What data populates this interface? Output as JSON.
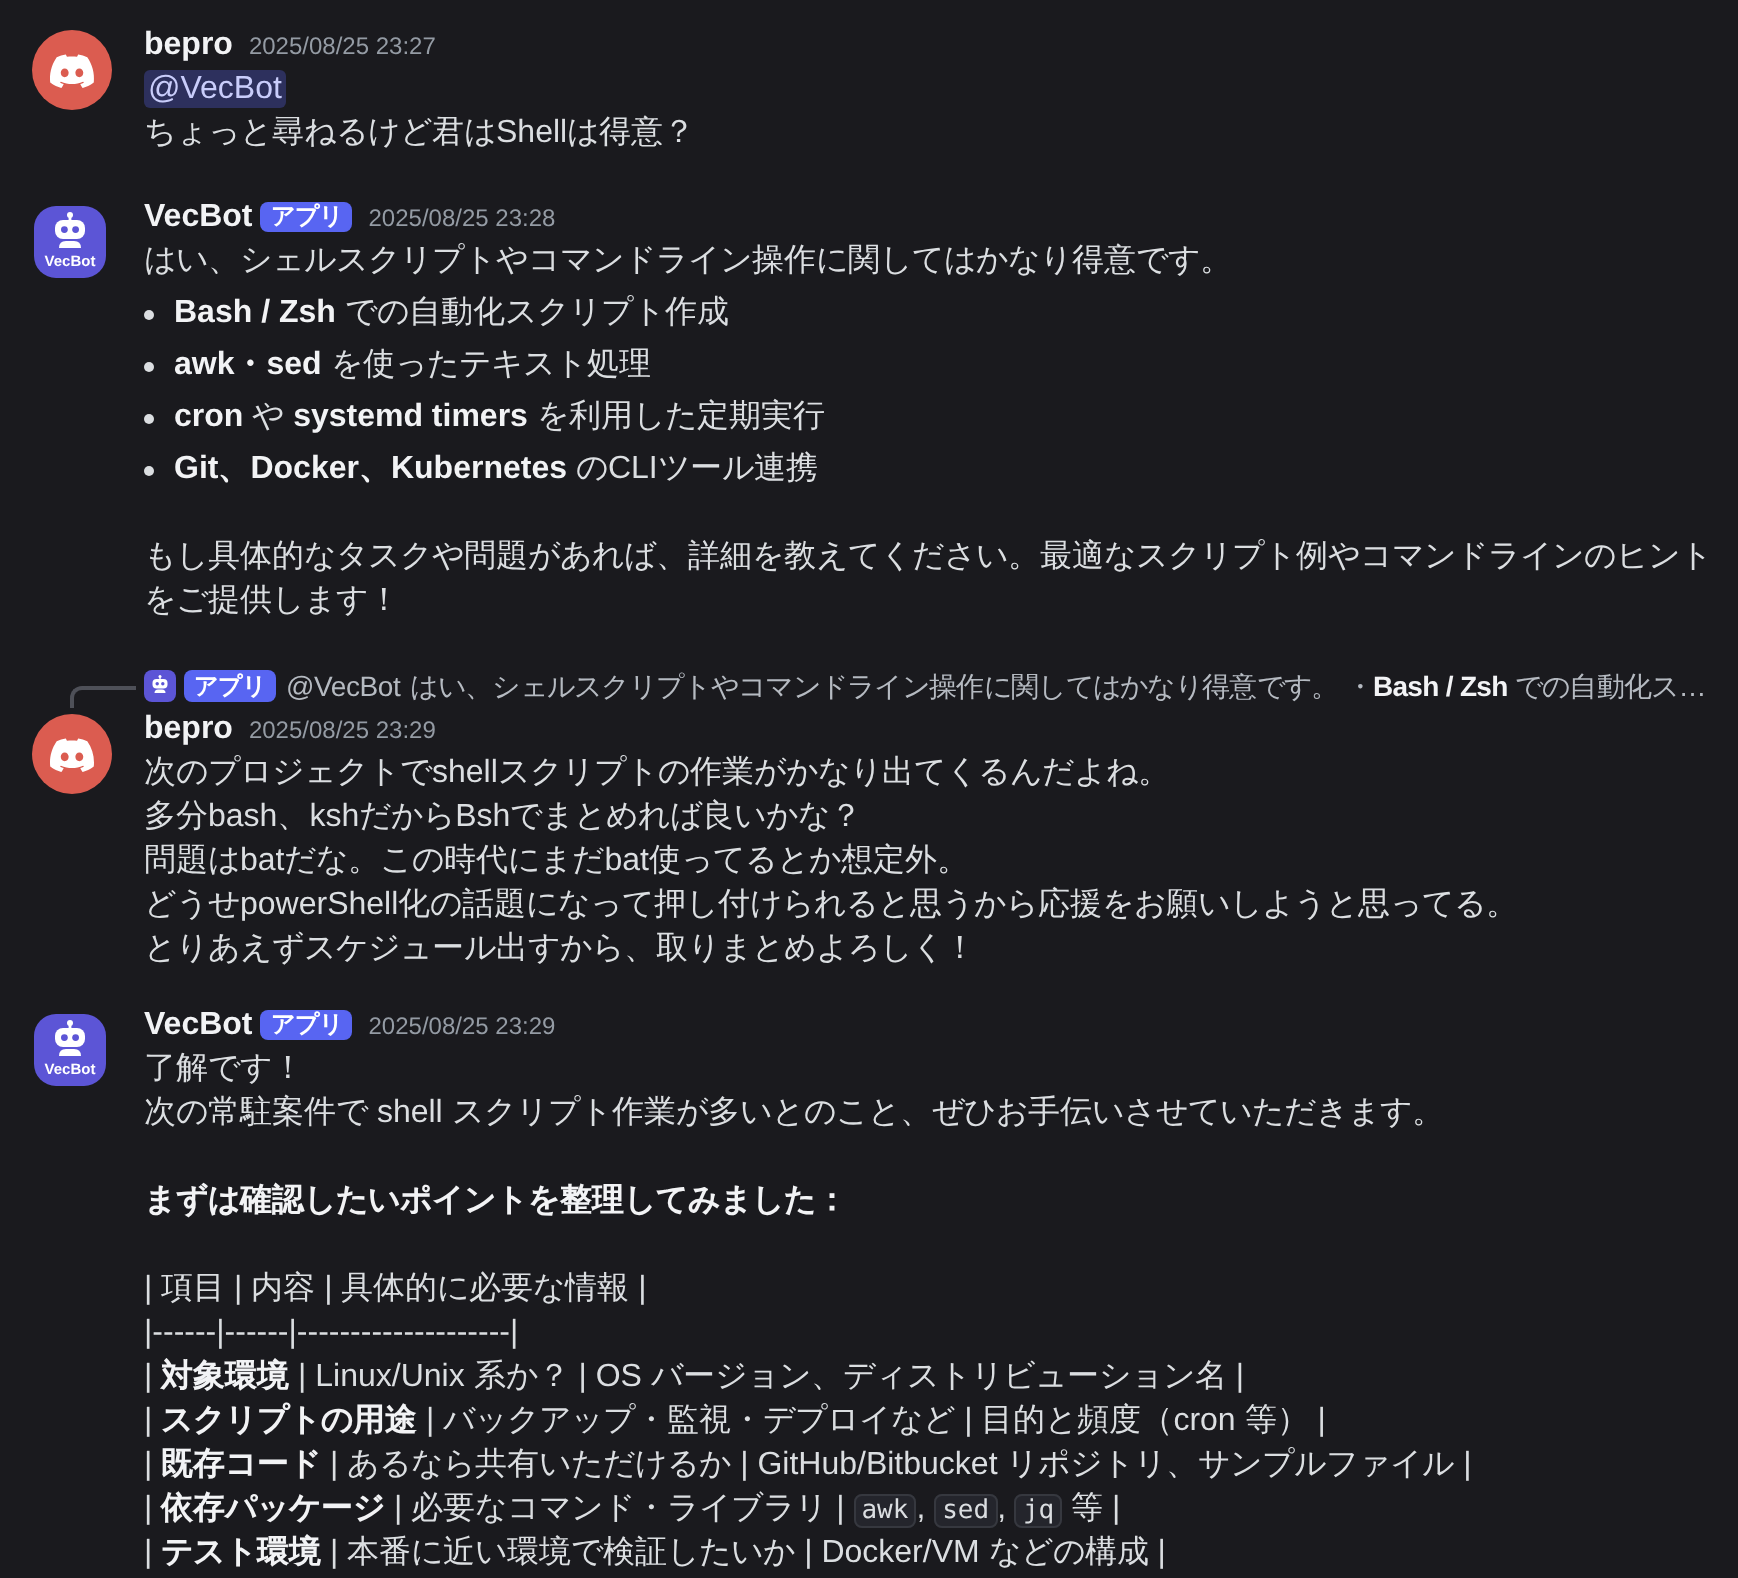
{
  "messages": [
    {
      "author": "bepro",
      "avatar": {
        "kind": "default"
      },
      "timestamp": "2025/08/25 23:27",
      "blocks": [
        {
          "kind": "mention",
          "text": "@VecBot"
        },
        {
          "kind": "paragraph",
          "bold": false,
          "lines": [
            "ちょっと尋ねるけど君はShellは得意？"
          ]
        }
      ]
    },
    {
      "author": "VecBot",
      "avatar": {
        "kind": "bot",
        "label": "VecBot"
      },
      "badge": "アプリ",
      "timestamp": "2025/08/25 23:28",
      "blocks": [
        {
          "kind": "paragraph",
          "bold": false,
          "lines": [
            "はい、シェルスクリプトやコマンドライン操作に関してはかなり得意です。"
          ]
        },
        {
          "kind": "list",
          "items": [
            "**Bash / Zsh** での自動化スクリプト作成",
            "**awk・sed** を使ったテキスト処理",
            "**cron** や **systemd timers** を利用した定期実行",
            "**Git、Docker、Kubernetes** のCLIツール連携"
          ]
        },
        {
          "kind": "paragraph",
          "bold": false,
          "lines": [
            "もし具体的なタスクや問題があれば、詳細を教えてください。最適なスクリプト例やコマンドラインのヒントをご提供します！"
          ]
        }
      ]
    },
    {
      "reply": {
        "avatar": {
          "kind": "bot"
        },
        "badge": "アプリ",
        "author": "@VecBot",
        "text": "はい、シェルスクリプトやコマンドライン操作に関してはかなり得意です。 ・**Bash / Zsh** での自動化ス…"
      },
      "author": "bepro",
      "avatar": {
        "kind": "default"
      },
      "timestamp": "2025/08/25 23:29",
      "blocks": [
        {
          "kind": "paragraph",
          "bold": false,
          "lines": [
            "次のプロジェクトでshellスクリプトの作業がかなり出てくるんだよね。",
            "多分bash、kshだからBshでまとめれば良いかな？",
            "問題はbatだな。この時代にまだbat使ってるとか想定外。",
            "どうせpowerShell化の話題になって押し付けられると思うから応援をお願いしようと思ってる。",
            "とりあえずスケジュール出すから、取りまとめよろしく！"
          ]
        }
      ]
    },
    {
      "author": "VecBot",
      "avatar": {
        "kind": "bot",
        "label": "VecBot"
      },
      "badge": "アプリ",
      "timestamp": "2025/08/25 23:29",
      "blocks": [
        {
          "kind": "paragraph",
          "bold": false,
          "lines": [
            "了解です！",
            "次の常駐案件で shell スクリプト作業が多いとのこと、ぜひお手伝いさせていただきます。"
          ]
        },
        {
          "kind": "paragraph",
          "bold": true,
          "lines": [
            "まずは確認したいポイントを整理してみました："
          ]
        },
        {
          "kind": "paragraph",
          "bold": false,
          "lines": [
            "| 項目 | 内容 | 具体的に必要な情報 |",
            "|------|------|--------------------|",
            "| **対象環境** | Linux/Unix 系か？ | OS バージョン、ディストリビューション名 |",
            "| **スクリプトの用途** | バックアップ・監視・デプロイなど | 目的と頻度（cron 等） |",
            "| **既存コード** | あるなら共有いただけるか | GitHub/Bitbucket リポジトリ、サンプルファイル |",
            [
              {
                "kind": "text",
                "text": "| **依存パッケージ** | 必要なコマンド・ライブラリ | "
              },
              {
                "kind": "code",
                "text": "awk"
              },
              {
                "kind": "text",
                "text": ", "
              },
              {
                "kind": "code",
                "text": "sed"
              },
              {
                "kind": "text",
                "text": ", "
              },
              {
                "kind": "code",
                "text": "jq"
              },
              {
                "kind": "text",
                "text": " 等 |"
              }
            ],
            "| **テスト環境** | 本番に近い環境で検証したいか | Docker/VM などの構成 |"
          ]
        }
      ]
    }
  ]
}
